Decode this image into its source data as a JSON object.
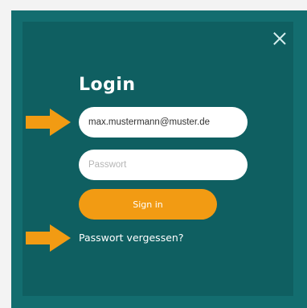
{
  "login": {
    "title": "Login",
    "email_value": "max.mustermann@muster.de",
    "password_placeholder": "Passwort",
    "signin_label": "Sign in",
    "forgot_label": "Passwort vergessen?"
  },
  "icons": {
    "close": "close-icon",
    "arrow": "arrow-right-icon"
  },
  "colors": {
    "frame": "#136d6f",
    "panel": "#0f5f61",
    "accent": "#f29b13",
    "text_light": "#ffffff"
  }
}
